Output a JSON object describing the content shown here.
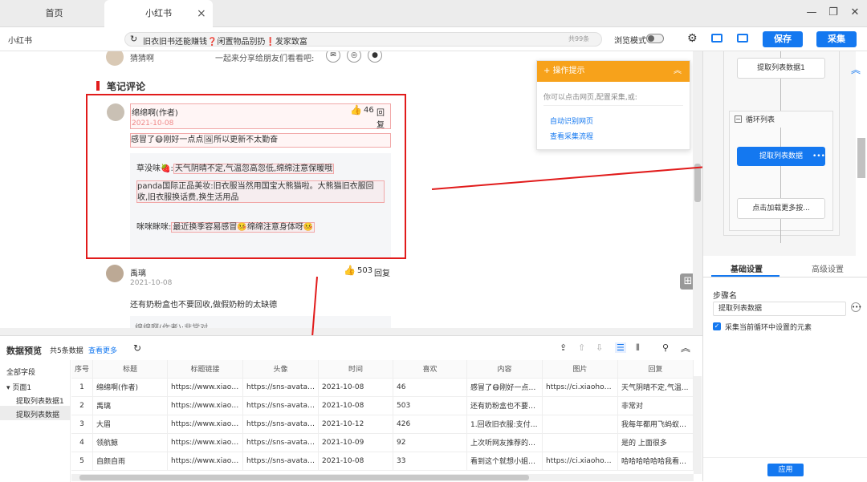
{
  "tabs": [
    {
      "label": "首页"
    },
    {
      "label": "小红书"
    }
  ],
  "address": {
    "site": "小红书",
    "url": "旧衣旧书还能赚钱❓闲置物品别扔❗发家致富",
    "zoom": "共99条"
  },
  "toolbar": {
    "browse_mode": "浏览模式",
    "save": "保存",
    "collect": "采集"
  },
  "page": {
    "top_user": "猜猜啊",
    "top_text": "一起来分享给朋友们看看吧:",
    "section_title": "笔记评论",
    "comment1": {
      "user": "绵绵啊(作者)",
      "date": "2021-10-08",
      "likes": "46",
      "reply": "回复",
      "text_a": "感冒了",
      "text_b": "刚好一点点",
      "text_c": "所以更新不太勤奋"
    },
    "replies": [
      {
        "who": "草没味🍓:",
        "text": "天气阴晴不定,气温忽高忽低,绵绵注意保暖哦"
      },
      {
        "who": "panda国际正品美妆:",
        "text": "旧衣服当然用国宝大熊猫啦。大熊猫旧衣服回收,旧衣服换话费,换生活用品"
      },
      {
        "who": "咪咪眯咪:",
        "text_a": "最近换季容易感冒",
        "text_b": "绵绵注意身体呀"
      }
    ],
    "comment2": {
      "user": "禹璃",
      "date": "2021-10-08",
      "likes": "503",
      "reply": "回复",
      "text": "还有奶粉盒也不要回收,做假奶粉的太缺德"
    },
    "comment2_reply": "绵绵啊(作者):非常对"
  },
  "popup": {
    "title": "操作提示",
    "desc": "你可以点击网页,配置采集,或:",
    "link1": "自动识别网页",
    "link2": "查看采集流程"
  },
  "flow": {
    "node1": "提取列表数据1",
    "loop": "循环列表",
    "node2": "提取列表数据",
    "node3": "点击加载更多按..."
  },
  "props": {
    "tab1": "基础设置",
    "tab2": "高级设置",
    "step_label": "步骤名",
    "step_value": "提取列表数据",
    "checkbox": "采集当前循环中设置的元素",
    "apply": "应用"
  },
  "preview": {
    "title": "数据预览",
    "count": "共5条数据",
    "more": "查看更多",
    "tree": [
      "全部字段",
      "页面1",
      "提取列表数据1",
      "提取列表数据"
    ],
    "columns": [
      "序号",
      "标题",
      "标题链接",
      "头像",
      "时间",
      "喜欢",
      "内容",
      "图片",
      "回复"
    ],
    "rows": [
      [
        "1",
        "绵绵啊(作者)",
        "https://www.xiaohon...",
        "https://sns-avatar-qc...",
        "2021-10-08",
        "46",
        "感冒了😷刚好一点点...",
        "https://ci.xiaohongsh...",
        "天气阴晴不定,气温..."
      ],
      [
        "2",
        "禹璃",
        "https://www.xiaohon...",
        "https://sns-avatar-qc...",
        "2021-10-08",
        "503",
        "还有奶粉盒也不要回...",
        "",
        "非常对"
      ],
      [
        "3",
        "大眉",
        "https://www.xiaohon...",
        "https://sns-avatar-qc...",
        "2021-10-12",
        "426",
        "1.回收旧衣服:支付宝...",
        "",
        "我每年都用飞蚂蚁处..."
      ],
      [
        "4",
        "领航鲸",
        "https://www.xiaohon...",
        "https://sns-avatar-qc...",
        "2021-10-09",
        "92",
        "上次听网友推荐的孔...",
        "",
        "是的 上面很多"
      ],
      [
        "5",
        "自颜自雨",
        "https://www.xiaohon...",
        "https://sns-avatar-qc...",
        "2021-10-08",
        "33",
        "看到这个就想小姐姐...",
        "https://ci.xiaohongsh...",
        "哈哈哈哈哈哈我看稍..."
      ]
    ]
  },
  "colors": {
    "accent": "#1478f0",
    "highlight": "#e11b1b",
    "popup": "#f7a21b"
  }
}
